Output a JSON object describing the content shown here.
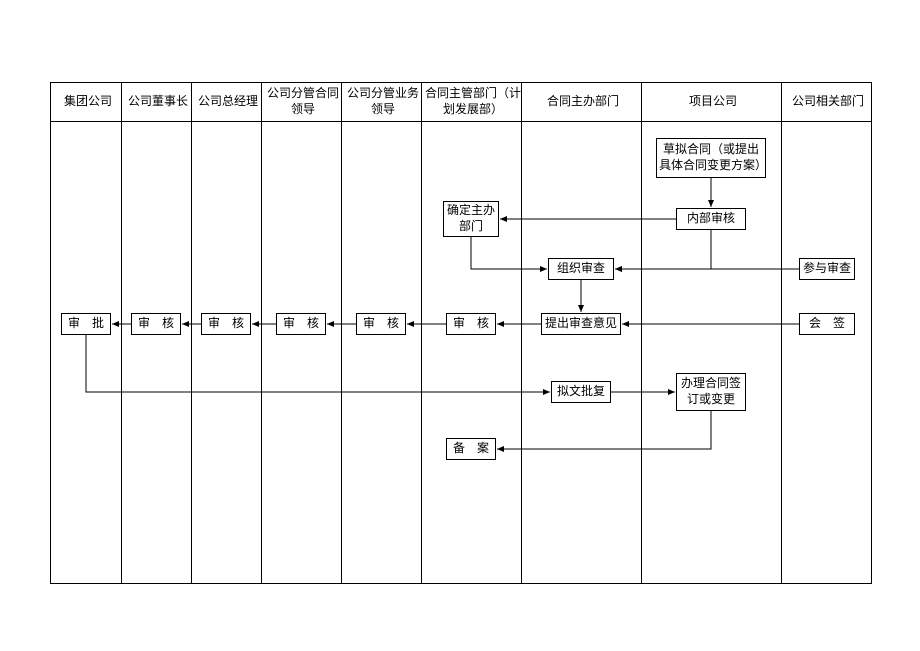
{
  "columns": [
    {
      "label": "集团公司"
    },
    {
      "label": "公司董事长"
    },
    {
      "label": "公司总经理"
    },
    {
      "label": "公司分管合同领导"
    },
    {
      "label": "公司分管业务领导"
    },
    {
      "label": "合同主管部门（计划发展部）"
    },
    {
      "label": "合同主办部门"
    },
    {
      "label": "项目公司"
    },
    {
      "label": "公司相关部门"
    }
  ],
  "nodes": {
    "draft": "草拟合同（或提出具体合同变更方案）",
    "internalReview": "内部审核",
    "determineDept": "确定主办部门",
    "orgReview": "组织审查",
    "joinReview": "参与审查",
    "opinion": "提出审查意见",
    "cosign": "会　签",
    "review1": "审　核",
    "review2": "审　核",
    "review3": "审　核",
    "review4": "审　核",
    "review5": "审　核",
    "approve": "审　批",
    "replyDoc": "拟文批复",
    "handle": "办理合同签订或变更",
    "archive": "备　案"
  }
}
